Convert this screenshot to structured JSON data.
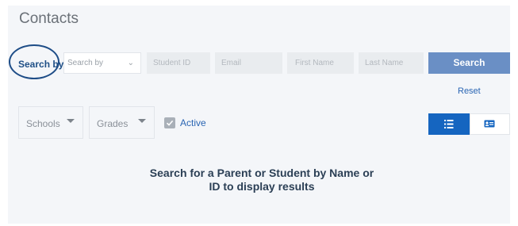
{
  "page": {
    "title": "Contacts"
  },
  "search": {
    "by_label": "Search by",
    "select_placeholder": "Search by",
    "fields": [
      "Student ID",
      "Email",
      "First Name",
      "Last Name"
    ],
    "search_button": "Search",
    "reset_link": "Reset"
  },
  "filters": {
    "schools": "Schools",
    "grades": "Grades",
    "active_label": "Active",
    "active_checked": true
  },
  "view_toggle": {
    "list_icon": "list-icon",
    "card_icon": "card-icon",
    "selected": "list"
  },
  "results": {
    "empty_message": "Search for a Parent or Student by Name or ID to display results"
  },
  "colors": {
    "accent": "#1565c0",
    "button": "#6a8fc5",
    "ring": "#1e4d87",
    "link": "#2a65b3"
  }
}
